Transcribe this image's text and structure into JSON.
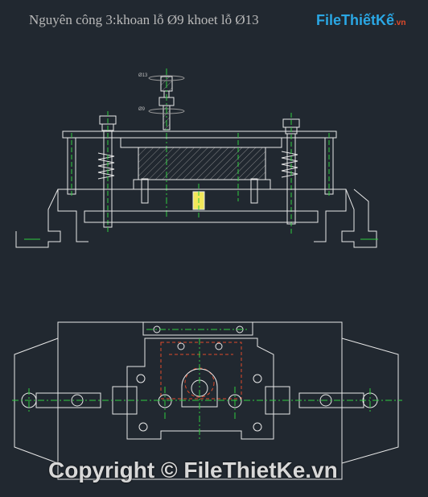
{
  "drawing": {
    "title": "Nguyên công 3:khoan lỗ Ø9 khoet lỗ Ø13",
    "small_label": "Ø13"
  },
  "logo": {
    "main": "FileThiếtKế",
    "suffix": ".vn"
  },
  "watermark": {
    "text": "Copyright © FileThietKe.vn"
  },
  "colors": {
    "background": "#212830",
    "outline": "#e8e8e8",
    "centerline": "#2ecc40",
    "hidden": "#e04a2a",
    "accent": "#f2e85a",
    "logo_blue": "#2aa7e4",
    "logo_red": "#e04a2a"
  }
}
